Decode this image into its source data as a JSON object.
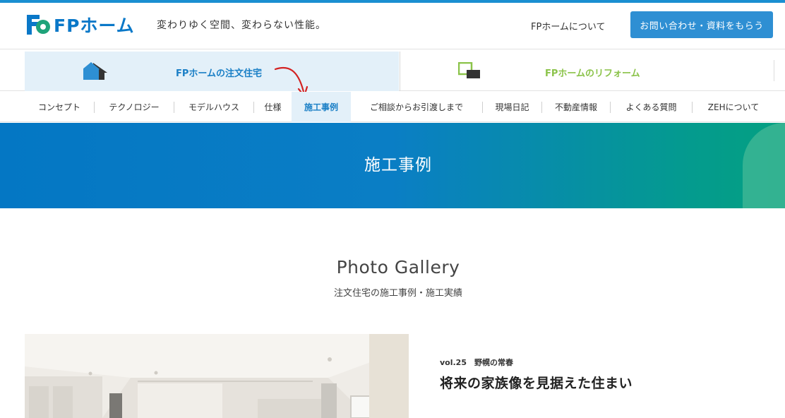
{
  "header": {
    "brand": "FPホーム",
    "tagline": "変わりゆく空間、変わらない性能。",
    "about_link": "FPホームについて",
    "contact_button": "お問い合わせ・資料をもらう",
    "brand_color": "#0a78c8"
  },
  "bigtabs": [
    {
      "label": "FPホームの注文住宅",
      "icon": "house-icon",
      "active": true
    },
    {
      "label": "FPホームのリフォーム",
      "icon": "reform-icon",
      "active": false
    }
  ],
  "subnav": [
    {
      "label": "コンセプト"
    },
    {
      "label": "テクノロジー"
    },
    {
      "label": "モデルハウス"
    },
    {
      "label": "仕様"
    },
    {
      "label": "施工事例",
      "active": true
    },
    {
      "label": "ご相談からお引渡しまで"
    },
    {
      "label": "現場日記"
    },
    {
      "label": "不動産情報"
    },
    {
      "label": "よくある質問"
    },
    {
      "label": "ZEHについて"
    }
  ],
  "banner": {
    "title": "施工事例"
  },
  "gallery": {
    "title": "Photo Gallery",
    "subtitle": "注文住宅の施工事例・施工実績"
  },
  "case": {
    "vol": "vol.25　野幌の常春",
    "title": "将来の家族像を見据えた住まい"
  },
  "colors": {
    "accent_blue": "#1a7fc6",
    "reform_green": "#8bc34a",
    "active_bg": "#e3f0f9"
  }
}
